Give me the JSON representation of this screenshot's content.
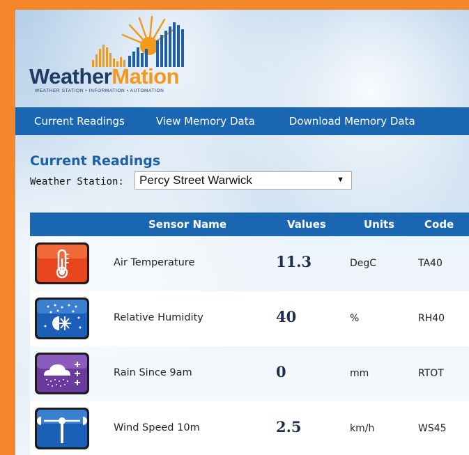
{
  "brand": {
    "name_part1": "Weather",
    "name_part2": "Mation",
    "tagline": "WEATHER STATION • INFORMATION • AUTOMATION"
  },
  "nav": {
    "items": [
      {
        "label": "Current Readings"
      },
      {
        "label": "View Memory Data"
      },
      {
        "label": "Download Memory Data"
      }
    ]
  },
  "section": {
    "title": "Current Readings",
    "station_label": "Weather Station:",
    "station_value": "Percy Street Warwick"
  },
  "table": {
    "headers": {
      "name": "Sensor Name",
      "value": "Values",
      "unit": "Units",
      "code": "Code"
    },
    "rows": [
      {
        "icon": "thermometer-icon",
        "icon_color": "#e8441d",
        "name": "Air Temperature",
        "value": "11.3",
        "unit": "DegC",
        "code": "TA40"
      },
      {
        "icon": "humidity-icon",
        "icon_color": "#1c5fb8",
        "name": "Relative Humidity",
        "value": "40",
        "unit": "%",
        "code": "RH40"
      },
      {
        "icon": "rain-icon",
        "icon_color": "#6b3a9e",
        "name": "Rain Since 9am",
        "value": "0",
        "unit": "mm",
        "code": "RTOT"
      },
      {
        "icon": "wind-speed-icon",
        "icon_color": "#1c5fb8",
        "name": "Wind Speed 10m",
        "value": "2.5",
        "unit": "km/h",
        "code": "WS45"
      }
    ]
  },
  "colors": {
    "frame": "#f4862c",
    "nav_bg": "#1b66b1",
    "title": "#1c5fa3"
  }
}
